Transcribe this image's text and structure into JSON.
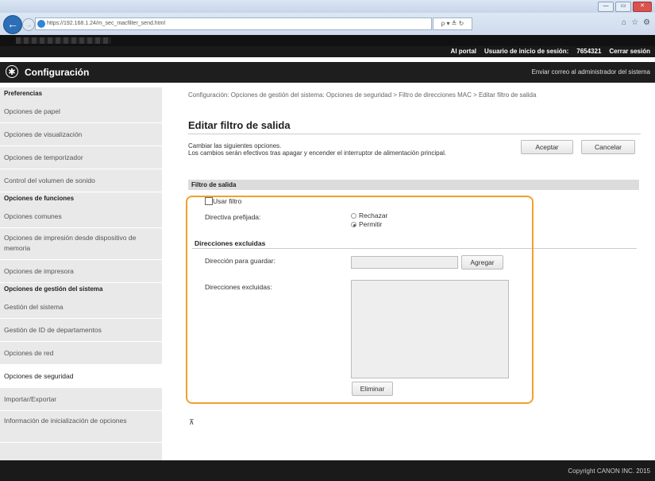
{
  "browser": {
    "url": "https://192.168.1.24/m_sec_macfilter_send.html",
    "url_controls": "ρ ▾ ≙ ↻",
    "window_buttons": [
      "—",
      "▭",
      "✕"
    ],
    "toolbar_icons": [
      "home-icon",
      "star-icon",
      "gear-icon"
    ]
  },
  "topnav": {
    "portal": "Al portal",
    "user_label": "Usuario de inicio de sesión:",
    "user_id": "7654321",
    "logout": "Cerrar sesión"
  },
  "header": {
    "title": "Configuración",
    "mail_admin": "Enviar correo al administrador del sistema"
  },
  "sidebar": {
    "section1": "Preferencias",
    "items1": [
      "Opciones de papel",
      "Opciones de visualización",
      "Opciones de temporizador",
      "Control del volumen de sonido"
    ],
    "section2": "Opciones de funciones",
    "items2": [
      "Opciones comunes",
      "Opciones de impresión desde dispositivo de memoria",
      "Opciones de impresora"
    ],
    "section3": "Opciones de gestión del sistema",
    "items3": [
      "Gestión del sistema",
      "Gestión de ID de departamentos",
      "Opciones de red",
      "Opciones de seguridad",
      "Importar/Exportar",
      "Información de inicialización de opciones"
    ]
  },
  "main": {
    "breadcrumb": "Configuración: Opciones de gestión del sistema: Opciones de seguridad > Filtro de direcciones MAC > Editar filtro de salida",
    "title": "Editar filtro de salida",
    "desc1": "Cambiar las siguientes opciones.",
    "desc2": "Los cambios serán efectivos tras apagar y encender el interruptor de alimentación principal.",
    "accept": "Aceptar",
    "cancel": "Cancelar"
  },
  "filter": {
    "section": "Filtro de salida",
    "use_filter": "Usar filtro",
    "default_policy_label": "Directiva prefijada:",
    "option_reject": "Rechazar",
    "option_allow": "Permitir",
    "excluded_section": "Direcciones excluidas",
    "save_address_label": "Dirección para guardar:",
    "add_button": "Agregar",
    "excluded_label": "Direcciones excluidas:",
    "delete_button": "Eliminar"
  },
  "footer": {
    "copyright": "Copyright CANON INC. 2015"
  }
}
